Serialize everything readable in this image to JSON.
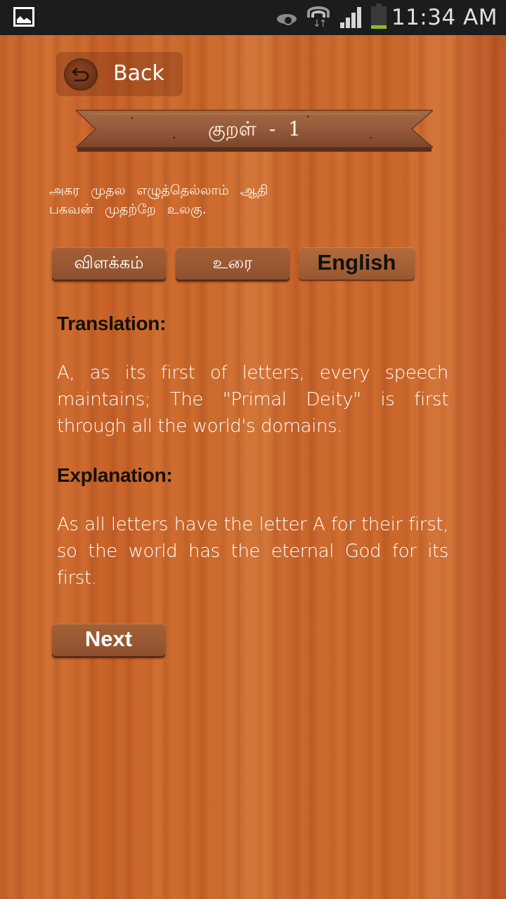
{
  "status_bar": {
    "notification_icon": "gallery-icon",
    "icons": [
      "eye-icon",
      "wifi-data-icon",
      "signal-icon",
      "battery-icon"
    ],
    "time": "11:34 AM",
    "battery_color": "#86c01e"
  },
  "header": {
    "back_label": "Back",
    "back_icon": "back-arrow-icon",
    "title": "குறள்  -  1"
  },
  "kural": {
    "line1": "அகர முதல எழுத்தெல்லாம் ஆதி",
    "line2": "பகவன் முதற்றே உலகு."
  },
  "tabs": [
    {
      "label": "விளக்கம்",
      "active": false
    },
    {
      "label": "உரை",
      "active": false
    },
    {
      "label": "English",
      "active": true
    }
  ],
  "content": {
    "translation_heading": "Translation:",
    "translation_text": "A, as its first of letters, every speech maintains; The \"Primal Deity\" is first through all the world's domains.",
    "explanation_heading": "Explanation:",
    "explanation_text": "As all letters have the letter A for their first, so the world has the eternal God for its first."
  },
  "footer": {
    "next_label": "Next"
  },
  "colors": {
    "wood_background": "#c9652a",
    "button_wood": "#9b5a33",
    "heading_text": "#141008",
    "body_text": "#ffffff"
  }
}
